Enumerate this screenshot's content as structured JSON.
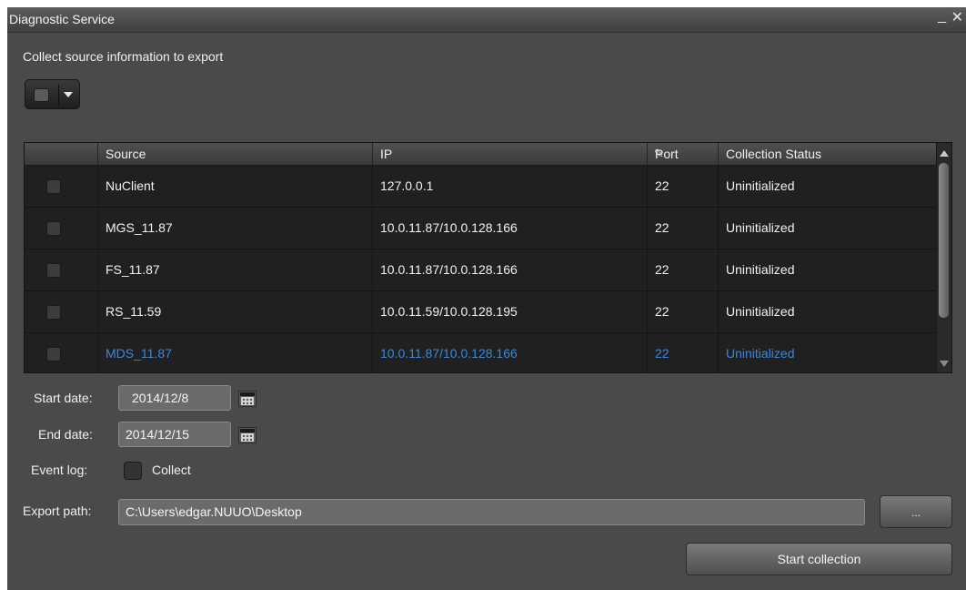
{
  "window": {
    "title": "Diagnostic Service",
    "minimize_glyph": "_",
    "close_glyph": "✕"
  },
  "subtitle": "Collect source information to export",
  "table": {
    "headers": {
      "source": "Source",
      "ip": "IP",
      "port": "Port",
      "status": "Collection Status"
    },
    "rows": [
      {
        "source": "NuClient",
        "ip": "127.0.0.1",
        "port": "22",
        "status": "Uninitialized"
      },
      {
        "source": "MGS_11.87",
        "ip": "10.0.11.87/10.0.128.166",
        "port": "22",
        "status": "Uninitialized"
      },
      {
        "source": "FS_11.87",
        "ip": "10.0.11.87/10.0.128.166",
        "port": "22",
        "status": "Uninitialized"
      },
      {
        "source": "RS_11.59",
        "ip": "10.0.11.59/10.0.128.195",
        "port": "22",
        "status": "Uninitialized"
      },
      {
        "source": "MDS_11.87",
        "ip": "10.0.11.87/10.0.128.166",
        "port": "22",
        "status": "Uninitialized"
      }
    ],
    "selected_row_color": "#3c88d6"
  },
  "form": {
    "start_date_label": "Start date:",
    "start_date_value": "2014/12/8",
    "end_date_label": "End date:",
    "end_date_value": "2014/12/15",
    "event_log_label": "Event log:",
    "collect_label": "Collect",
    "export_path_label": "Export path:",
    "export_path_value": "C:\\Users\\edgar.NUUO\\Desktop",
    "browse_label": "...",
    "start_button_label": "Start collection"
  }
}
